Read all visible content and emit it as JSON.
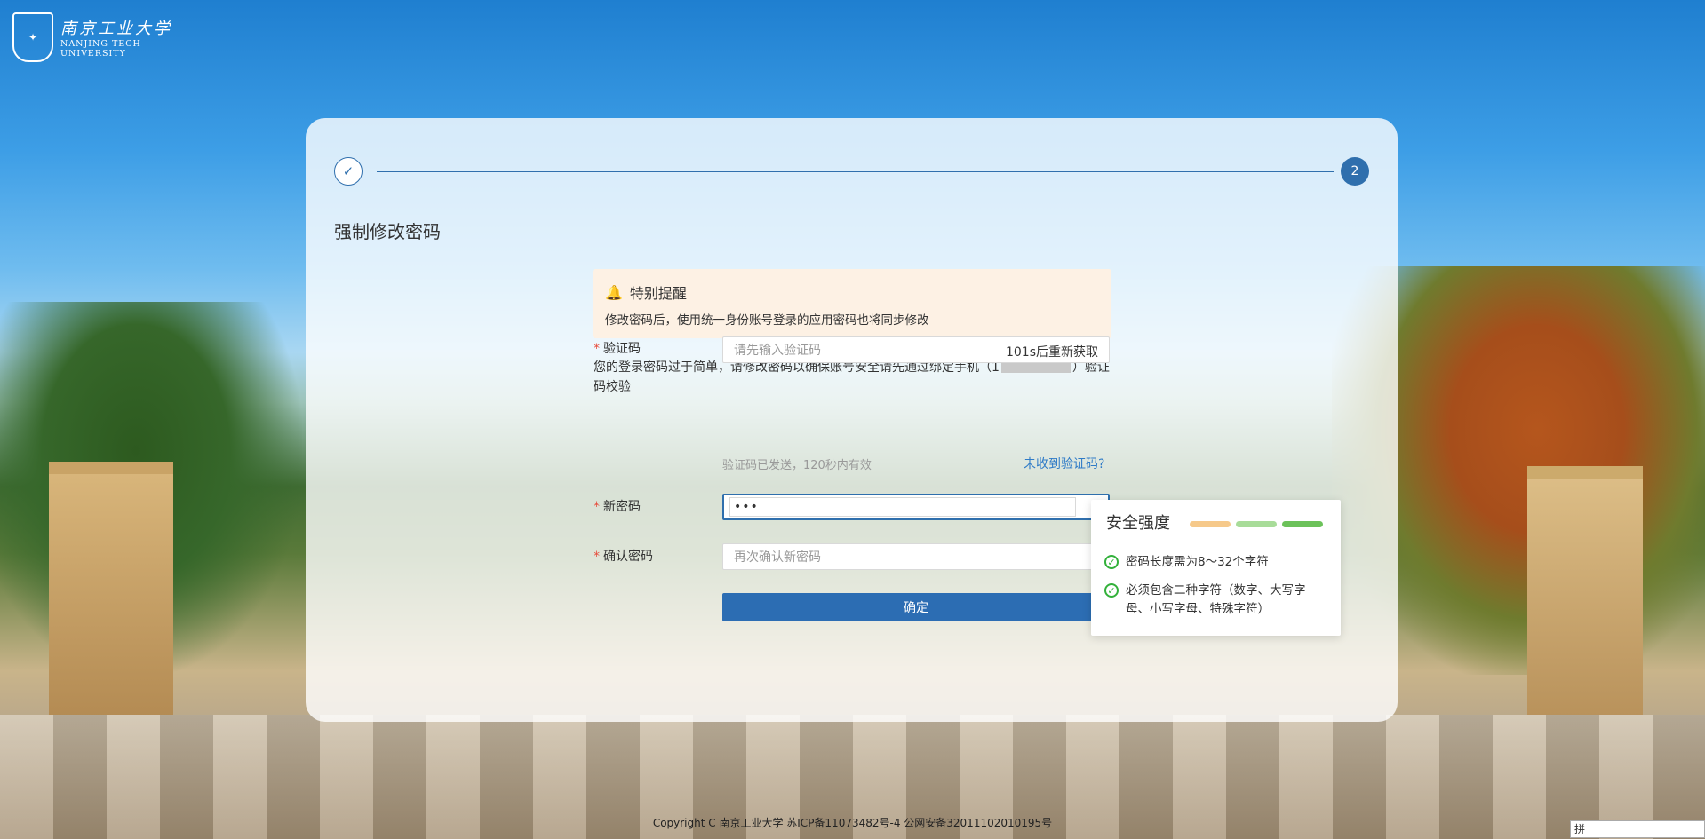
{
  "logo": {
    "cn": "南京工业大学",
    "en_line1": "NANJING TECH",
    "en_line2": "UNIVERSITY"
  },
  "steps": {
    "current": "2",
    "done_icon": "check-icon"
  },
  "page_title": "强制修改密码",
  "notice": {
    "title": "特别提醒",
    "body": "修改密码后，使用统一身份账号登录的应用密码也将同步修改"
  },
  "description": {
    "before": "您的登录密码过于简单，请修改密码以确保账号安全请先通过绑定手机（1",
    "after": "）验证码校验"
  },
  "form": {
    "code_label": "验证码",
    "code_placeholder": "请先输入验证码",
    "code_button": "101s后重新获取",
    "code_hint": "验证码已发送，120秒内有效",
    "resend_link": "未收到验证码?",
    "new_pw_label": "新密码",
    "new_pw_value": "•••",
    "confirm_label": "确认密码",
    "confirm_placeholder": "再次确认新密码",
    "submit": "确定"
  },
  "strength": {
    "title": "安全强度",
    "bar_colors": [
      "#f6c98a",
      "#a8dc99",
      "#6cc25a"
    ],
    "rules": [
      "密码长度需为8～32个字符",
      "必须包含二种字符（数字、大写字母、小写字母、特殊字符）"
    ]
  },
  "footer": "Copyright C 南京工业大学 苏ICP备11073482号-4 公网安备32011102010195号",
  "ime_indicator": "拼"
}
